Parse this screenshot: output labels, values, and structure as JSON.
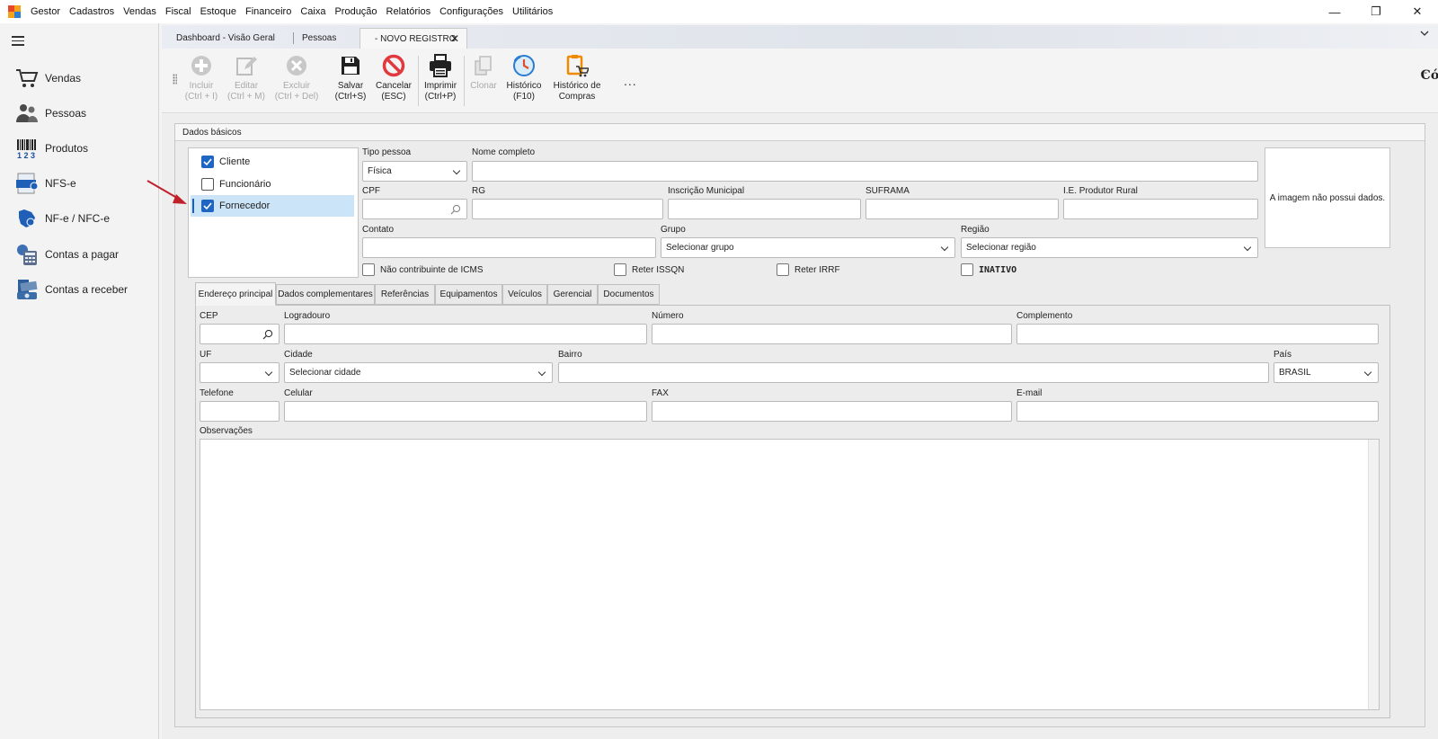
{
  "menu": {
    "items": [
      "Gestor",
      "Cadastros",
      "Vendas",
      "Fiscal",
      "Estoque",
      "Financeiro",
      "Caixa",
      "Produção",
      "Relatórios",
      "Configurações",
      "Utilitários"
    ]
  },
  "window": {
    "minimize": "—",
    "restore": "❐",
    "close": "✕"
  },
  "sidebar": {
    "items": [
      {
        "label": "Vendas",
        "icon": "cart-icon"
      },
      {
        "label": "Pessoas",
        "icon": "people-icon"
      },
      {
        "label": "Produtos",
        "icon": "barcode-icon"
      },
      {
        "label": "NFS-e",
        "icon": "nfse-icon"
      },
      {
        "label": "NF-e / NFC-e",
        "icon": "nfe-icon"
      },
      {
        "label": "Contas a pagar",
        "icon": "calculator-icon"
      },
      {
        "label": "Contas a receber",
        "icon": "money-icon"
      }
    ]
  },
  "tabs": [
    {
      "label": "Dashboard - Visão Geral"
    },
    {
      "label": "Pessoas"
    },
    {
      "label": "- NOVO REGISTRO",
      "close": "✕"
    }
  ],
  "toolbar": {
    "incluir": {
      "line1": "Incluir",
      "line2": "(Ctrl + I)"
    },
    "editar": {
      "line1": "Editar",
      "line2": "(Ctrl + M)"
    },
    "excluir": {
      "line1": "Excluir",
      "line2": "(Ctrl + Del)"
    },
    "salvar": {
      "line1": "Salvar",
      "line2": "(Ctrl+S)"
    },
    "cancelar": {
      "line1": "Cancelar",
      "line2": "(ESC)"
    },
    "imprimir": {
      "line1": "Imprimir",
      "line2": "(Ctrl+P)"
    },
    "clonar": {
      "line1": "Clonar",
      "line2": ""
    },
    "historico": {
      "line1": "Histórico",
      "line2": "(F10)"
    },
    "historico_compras": {
      "line1": "Histórico de",
      "line2": "Compras"
    },
    "more": "...",
    "codigo_label": "Código",
    "codigo_value": "--"
  },
  "form": {
    "group_title": "Dados básicos",
    "roles": [
      {
        "label": "Cliente",
        "checked": true
      },
      {
        "label": "Funcionário",
        "checked": false
      },
      {
        "label": "Fornecedor",
        "checked": true
      }
    ],
    "tipo_pessoa": {
      "label": "Tipo pessoa",
      "value": "Física"
    },
    "nome_completo": {
      "label": "Nome completo",
      "value": ""
    },
    "cpf": {
      "label": "CPF"
    },
    "rg": {
      "label": "RG"
    },
    "inscricao_municipal": {
      "label": "Inscrição Municipal"
    },
    "suframa": {
      "label": "SUFRAMA"
    },
    "ie_produtor": {
      "label": "I.E. Produtor Rural"
    },
    "contato": {
      "label": "Contato"
    },
    "grupo": {
      "label": "Grupo",
      "value": "Selecionar grupo"
    },
    "regiao": {
      "label": "Região",
      "value": "Selecionar região"
    },
    "nao_contribuinte": {
      "label": "Não contribuinte de ICMS"
    },
    "reter_issqn": {
      "label": "Reter ISSQN"
    },
    "reter_irrf": {
      "label": "Reter IRRF"
    },
    "inativo": {
      "label": "INATIVO"
    },
    "image_text": "A imagem não possui dados."
  },
  "inner_tabs": [
    "Endereço principal",
    "Dados complementares",
    "Referências",
    "Equipamentos",
    "Veículos",
    "Gerencial",
    "Documentos"
  ],
  "address": {
    "cep": "CEP",
    "logradouro": "Logradouro",
    "numero": "Número",
    "complemento": "Complemento",
    "uf": "UF",
    "cidade": {
      "label": "Cidade",
      "value": "Selecionar cidade"
    },
    "bairro": "Bairro",
    "pais": {
      "label": "País",
      "value": "BRASIL"
    },
    "telefone": "Telefone",
    "celular": "Celular",
    "fax": "FAX",
    "email": "E-mail",
    "observacoes": "Observações"
  },
  "colors": {
    "accent": "#1f66c2",
    "selection": "#cce4f7",
    "cancel_red": "#e0393e",
    "arrow_red": "#c0202a"
  }
}
